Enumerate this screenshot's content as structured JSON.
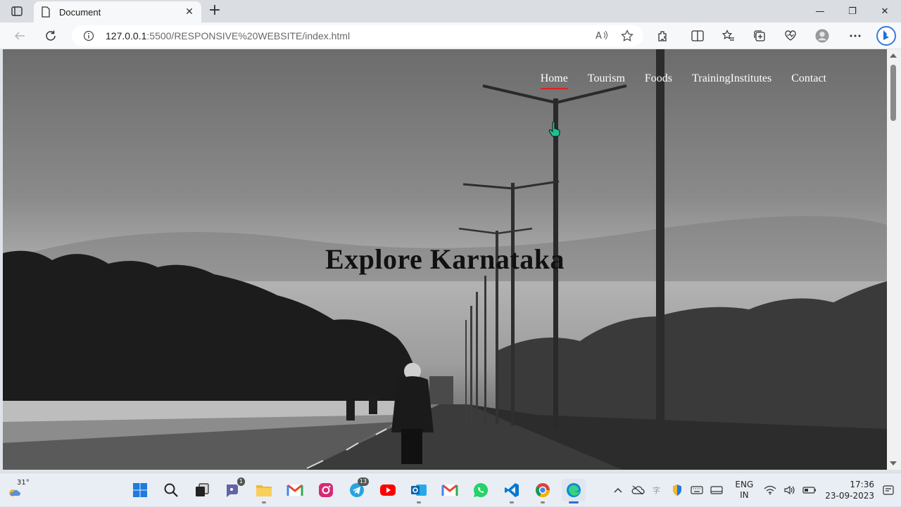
{
  "browser": {
    "tab_title": "Document",
    "tab_close": "✕",
    "new_tab": "+",
    "url_host": "127.0.0.1",
    "url_path": ":5500/RESPONSIVE%20WEBSITE/index.html",
    "window_controls": [
      "—",
      "❐",
      "✕"
    ]
  },
  "page": {
    "nav": [
      {
        "label": "Home",
        "active": true
      },
      {
        "label": "Tourism"
      },
      {
        "label": "Foods"
      },
      {
        "label": "TrainingInstitutes"
      },
      {
        "label": "Contact"
      }
    ],
    "hero_title": "Explore Karnataka"
  },
  "taskbar": {
    "weather_temp": "31°",
    "apps": [
      {
        "name": "windows-start-icon"
      },
      {
        "name": "search-icon"
      },
      {
        "name": "task-view-icon"
      },
      {
        "name": "teams-icon",
        "badge": "1"
      },
      {
        "name": "file-explorer-icon"
      },
      {
        "name": "gmail-icon"
      },
      {
        "name": "instagram-icon"
      },
      {
        "name": "telegram-icon",
        "badge": "13"
      },
      {
        "name": "youtube-icon"
      },
      {
        "name": "outlook-icon"
      },
      {
        "name": "gmail-2-icon"
      },
      {
        "name": "whatsapp-icon"
      },
      {
        "name": "vscode-icon"
      },
      {
        "name": "chrome-icon"
      },
      {
        "name": "edge-icon"
      }
    ],
    "lang_line1": "ENG",
    "lang_line2": "IN",
    "time": "17:36",
    "date": "23-09-2023"
  },
  "colors": {
    "active_underline": "#e02020",
    "hero_title": "#111111",
    "nav_text": "#ffffff"
  }
}
